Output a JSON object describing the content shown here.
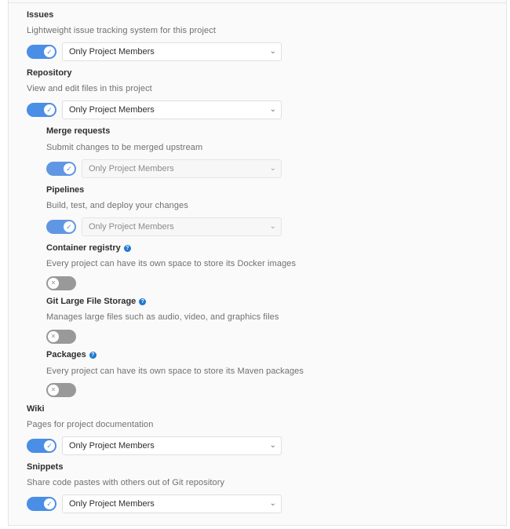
{
  "sections": {
    "issues": {
      "title": "Issues",
      "description": "Lightweight issue tracking system for this project",
      "access": "Only Project Members",
      "enabled": true
    },
    "repository": {
      "title": "Repository",
      "description": "View and edit files in this project",
      "access": "Only Project Members",
      "enabled": true
    },
    "merge_requests": {
      "title": "Merge requests",
      "description": "Submit changes to be merged upstream",
      "access": "Only Project Members",
      "enabled": true
    },
    "pipelines": {
      "title": "Pipelines",
      "description": "Build, test, and deploy your changes",
      "access": "Only Project Members",
      "enabled": true
    },
    "container_registry": {
      "title": "Container registry",
      "description": "Every project can have its own space to store its Docker images",
      "enabled": false
    },
    "lfs": {
      "title": "Git Large File Storage",
      "description": "Manages large files such as audio, video, and graphics files",
      "enabled": false
    },
    "packages": {
      "title": "Packages",
      "description": "Every project can have its own space to store its Maven packages",
      "enabled": false
    },
    "wiki": {
      "title": "Wiki",
      "description": "Pages for project documentation",
      "access": "Only Project Members",
      "enabled": true
    },
    "snippets": {
      "title": "Snippets",
      "description": "Share code pastes with others out of Git repository",
      "access": "Only Project Members",
      "enabled": true
    }
  },
  "icons": {
    "help": "question-circle-icon",
    "toggle_on": "check-icon",
    "toggle_off": "close-icon",
    "dropdown": "chevron-down-icon"
  },
  "colors": {
    "toggle_on": "#4a8ee6",
    "toggle_off": "#999999",
    "help": "#1f78d1"
  }
}
